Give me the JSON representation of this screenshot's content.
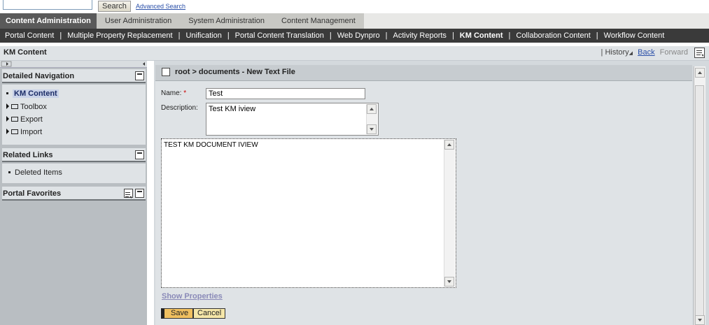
{
  "search": {
    "input_value": "",
    "button_label": "Search",
    "advanced_label": "Advanced Search"
  },
  "nav1": {
    "tabs": [
      {
        "label": "Content Administration"
      },
      {
        "label": "User Administration"
      },
      {
        "label": "System Administration"
      },
      {
        "label": "Content Management"
      }
    ]
  },
  "nav2": {
    "items": [
      {
        "label": "Portal Content"
      },
      {
        "label": "Multiple Property Replacement"
      },
      {
        "label": "Unification"
      },
      {
        "label": "Portal Content Translation"
      },
      {
        "label": "Web Dynpro"
      },
      {
        "label": "Activity Reports"
      },
      {
        "label": "KM Content"
      },
      {
        "label": "Collaboration Content"
      },
      {
        "label": "Workflow Content"
      }
    ],
    "separator": "|"
  },
  "titlebar": {
    "title": "KM Content",
    "pipe": "|",
    "history": "History",
    "back": "Back",
    "forward": "Forward"
  },
  "left": {
    "detailed_navigation": {
      "title": "Detailed Navigation",
      "items": [
        {
          "label": "KM Content"
        },
        {
          "label": "Toolbox"
        },
        {
          "label": "Export"
        },
        {
          "label": "Import"
        }
      ]
    },
    "related_links": {
      "title": "Related Links",
      "items": [
        {
          "label": "Deleted Items"
        }
      ]
    },
    "portal_favorites": {
      "title": "Portal Favorites"
    }
  },
  "main": {
    "breadcrumb": "root > documents - New Text File",
    "name_label": "Name:",
    "required_mark": "*",
    "name_value": "Test",
    "description_label": "Description:",
    "description_value": "Test KM iview",
    "body_value": "TEST KM DOCUMENT IVIEW",
    "show_properties": "Show Properties",
    "save_label": "Save",
    "cancel_label": "Cancel"
  },
  "colors": {
    "nav_dark": "#3a3a3a",
    "active_tab": "#5a5a5a",
    "panel_bg": "#dfe3e6",
    "save_button": "#f0c060",
    "link": "#2a4fa8"
  }
}
